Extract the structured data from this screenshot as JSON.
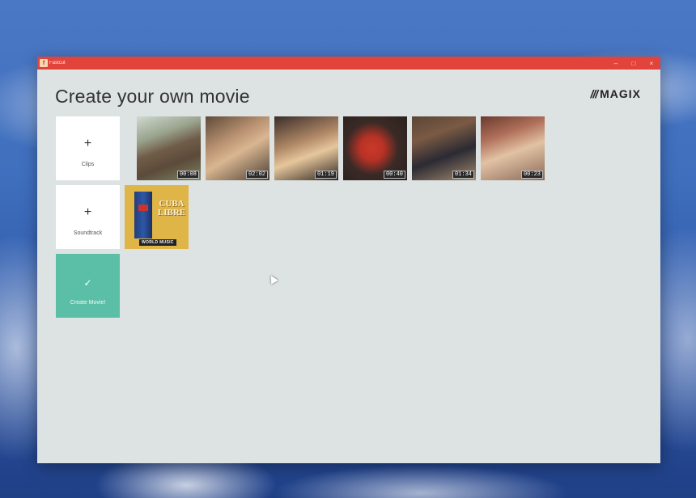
{
  "window": {
    "title": "Fastcut",
    "app_icon": "fastcut-app-icon",
    "controls": {
      "minimize": "–",
      "maximize": "□",
      "close": "×"
    },
    "titlebar_color": "#e2433b"
  },
  "header": {
    "title": "Create your own movie",
    "logo_slashes": "///",
    "logo_text": "MAGIX"
  },
  "tiles": {
    "clips": {
      "icon": "+",
      "label": "Clips"
    },
    "soundtrack": {
      "icon": "+",
      "label": "Soundtrack"
    },
    "create": {
      "icon": "✓",
      "label": "Create Movie!",
      "color": "#5bbfa8"
    }
  },
  "clips": [
    {
      "duration": "00:08"
    },
    {
      "duration": "02:02"
    },
    {
      "duration": "01:19"
    },
    {
      "duration": "00:40"
    },
    {
      "duration": "01:34"
    },
    {
      "duration": "00:23"
    }
  ],
  "soundtrack": {
    "album_title_line1": "CUBA",
    "album_title_line2": "LIBRE",
    "album_label": "WORLD MUSIC"
  }
}
